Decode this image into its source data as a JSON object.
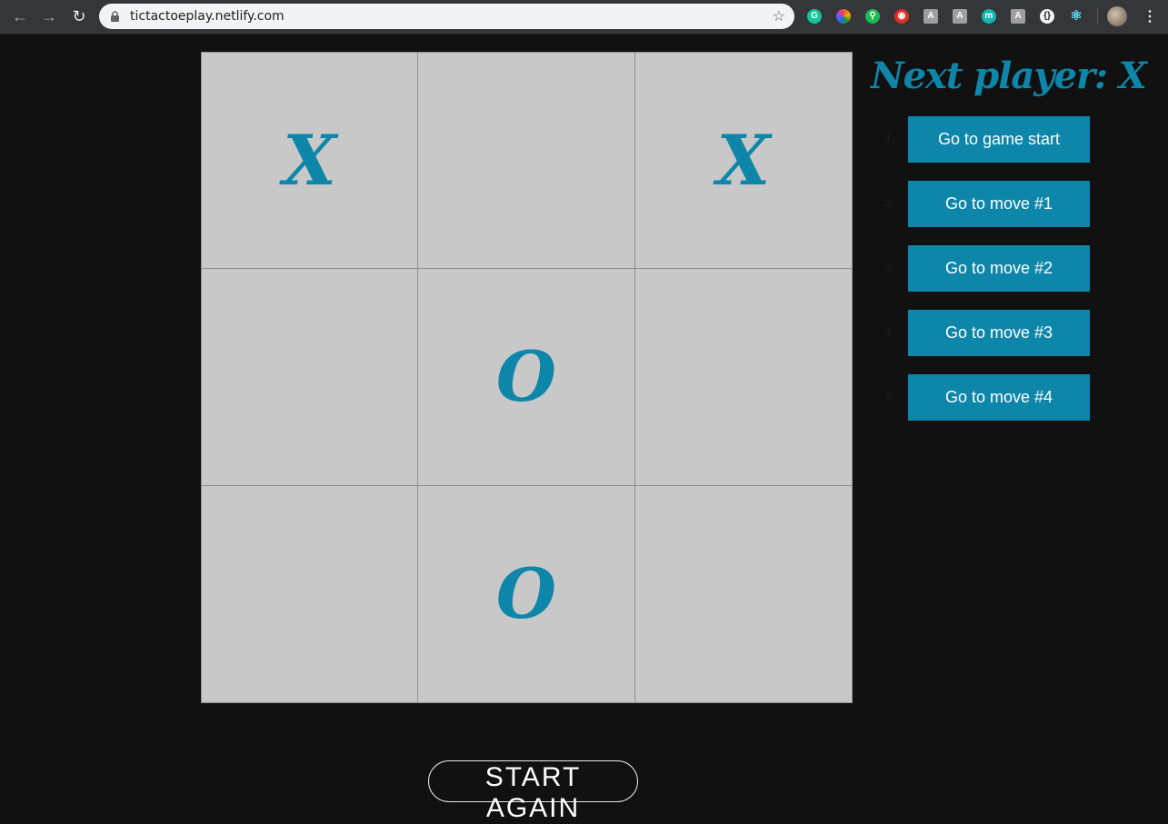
{
  "browser": {
    "url": "tictactoeplay.netlify.com",
    "extensions": [
      {
        "icon": "grammarly-icon",
        "glyph": "G",
        "color": "#15c39a"
      },
      {
        "icon": "color-wheel-icon",
        "glyph": "",
        "color": "#e94b3c"
      },
      {
        "icon": "green-extension-icon",
        "glyph": "⚲",
        "color": "#1db954"
      },
      {
        "icon": "red-circle-icon",
        "glyph": "◉",
        "color": "#d93025"
      },
      {
        "icon": "font-a-icon",
        "glyph": "A",
        "color": "#9e9e9e"
      },
      {
        "icon": "font-a-icon-2",
        "glyph": "A",
        "color": "#9e9e9e"
      },
      {
        "icon": "teal-m-icon",
        "glyph": "m",
        "color": "#12b5b0"
      },
      {
        "icon": "font-a-icon-3",
        "glyph": "A",
        "color": "#9e9e9e"
      },
      {
        "icon": "devtools-icon",
        "glyph": "{}",
        "color": "#f1f3f4"
      },
      {
        "icon": "react-icon",
        "glyph": "⚛",
        "color": "#61dafb"
      }
    ]
  },
  "game": {
    "squares": [
      "X",
      "",
      "X",
      "",
      "O",
      "",
      "",
      "O",
      ""
    ],
    "status": "Next player: X",
    "moves": [
      {
        "number": "1.",
        "label": "Go to game start"
      },
      {
        "number": "2.",
        "label": "Go to move #1"
      },
      {
        "number": "3.",
        "label": "Go to move #2"
      },
      {
        "number": "4.",
        "label": "Go to move #3"
      },
      {
        "number": "5.",
        "label": "Go to move #4"
      }
    ],
    "restart_label": "START AGAIN"
  },
  "colors": {
    "accent": "#0e86aa",
    "board": "#c8c8c8",
    "background": "#111111"
  }
}
